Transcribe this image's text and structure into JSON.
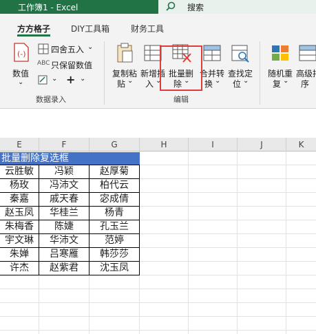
{
  "window": {
    "title": "工作簿1  -  Excel",
    "search_label": "搜索"
  },
  "tabs": [
    "方方格子",
    "DIY工具箱",
    "财务工具"
  ],
  "ribbon": {
    "numeric": {
      "label": "数值"
    },
    "round": {
      "label": "四舍五入",
      "keep_value": "只保留数值",
      "keep_value_prefix": "ABC"
    },
    "data_entry_group": "数据录入",
    "copy_paste": {
      "line1": "复制粘",
      "line2": "贴"
    },
    "new_insert": {
      "line1": "新增插",
      "line2": "入"
    },
    "batch_delete": {
      "line1": "批量删",
      "line2": "除"
    },
    "merge_convert": {
      "line1": "合并转",
      "line2": "换"
    },
    "find_locate": {
      "line1": "查找定",
      "line2": "位"
    },
    "edit_group": "编辑",
    "random_repeat": {
      "line1": "随机重",
      "line2": "复"
    },
    "advanced_sort": {
      "line1": "高级排",
      "line2": "序"
    }
  },
  "grid": {
    "columns": [
      "E",
      "F",
      "G",
      "H",
      "I",
      "J",
      "K"
    ],
    "header_text": "批量删除复选框",
    "rows": [
      [
        "云胜敏",
        "冯颖",
        "赵厚菊"
      ],
      [
        "杨玫",
        "冯沛文",
        "柏代云"
      ],
      [
        "秦嘉",
        "戚天春",
        "宓成倩"
      ],
      [
        "赵玉凤",
        "华桂兰",
        "杨青"
      ],
      [
        "朱梅香",
        "陈婕",
        "孔玉兰"
      ],
      [
        "宇文琳",
        "华沛文",
        "范婷"
      ],
      [
        "朱婵",
        "吕寒雁",
        "韩莎莎"
      ],
      [
        "许杰",
        "赵紫君",
        "沈玉凤"
      ]
    ]
  },
  "colors": {
    "excel_green": "#217346",
    "header_blue": "#4472c4",
    "highlight_red": "#e03b3b"
  }
}
